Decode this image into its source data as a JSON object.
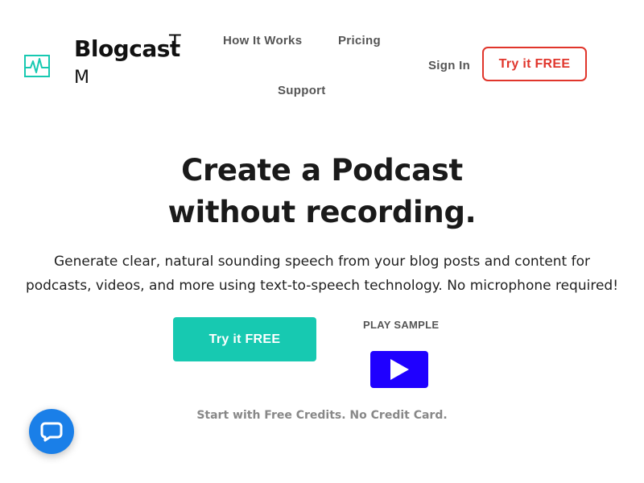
{
  "brand": {
    "name": "Blogcast",
    "tm_t": "T",
    "tm_m": "M"
  },
  "nav": {
    "how_it_works": "How It Works",
    "pricing": "Pricing",
    "support": "Support",
    "sign_in": "Sign In",
    "try_free": "Try it FREE"
  },
  "hero": {
    "title_line1": "Create a Podcast",
    "title_line2": "without recording.",
    "sub_line1": "Generate clear, natural sounding speech from your blog posts and content for",
    "sub_line2": "podcasts, videos, and more using text-to-speech technology. No microphone required!",
    "cta_try": "Try it FREE",
    "play_label": "PLAY SAMPLE",
    "credits_note": "Start with Free Credits. No Credit Card."
  },
  "icons": {
    "logo": "waveform-icon",
    "play": "play-icon",
    "chat": "chat-bubble-icon"
  },
  "colors": {
    "accent_teal": "#17c9b1",
    "accent_red": "#e0352b",
    "play_blue": "#1f00ff",
    "chat_blue": "#1a7fe8"
  }
}
